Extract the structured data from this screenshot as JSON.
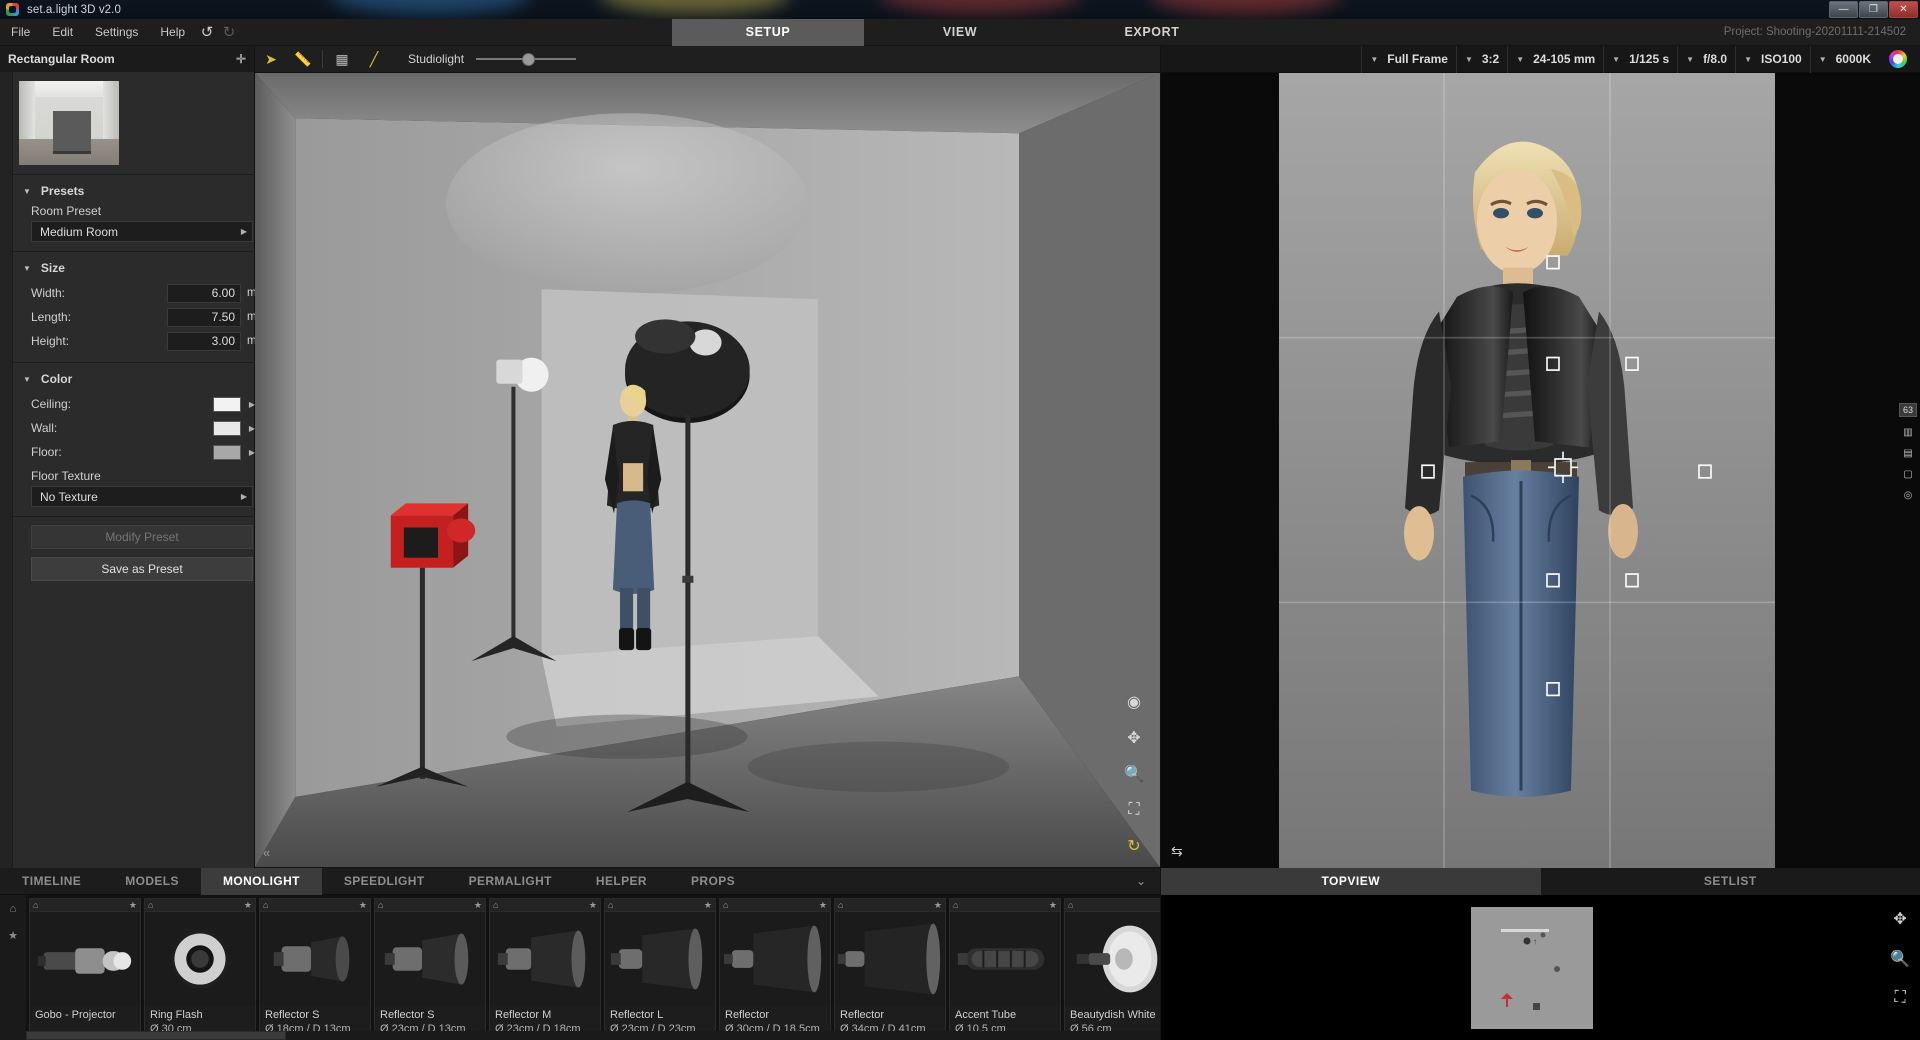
{
  "window": {
    "app_title": "set.a.light 3D v2.0",
    "logo_icon": "app-logo-icon",
    "minimize_icon": "minimize-icon",
    "maximize_icon": "maximize-icon",
    "close_icon": "close-icon",
    "minimize_glyph": "—",
    "maximize_glyph": "❐",
    "close_glyph": "✕"
  },
  "menu": {
    "items": [
      "File",
      "Edit",
      "Settings",
      "Help"
    ],
    "undo_glyph": "↺",
    "redo_glyph": "↻",
    "project_label": "Project: Shooting-20201111-214502"
  },
  "nav_tabs": [
    {
      "label": "SETUP",
      "active": true
    },
    {
      "label": "VIEW",
      "active": false
    },
    {
      "label": "EXPORT",
      "active": false
    }
  ],
  "sidebar": {
    "header": "Rectangular Room",
    "pin_glyph": "📌",
    "presets": {
      "section_label": "Presets",
      "caret_glyph": "▼",
      "field_label": "Room Preset",
      "value": "Medium Room",
      "arrow_glyph": "▶"
    },
    "size": {
      "section_label": "Size",
      "caret_glyph": "▼",
      "rows": [
        {
          "label": "Width:",
          "value": "6.00",
          "unit": "m"
        },
        {
          "label": "Length:",
          "value": "7.50",
          "unit": "m"
        },
        {
          "label": "Height:",
          "value": "3.00",
          "unit": "m"
        }
      ]
    },
    "color": {
      "section_label": "Color",
      "caret_glyph": "▼",
      "rows": [
        {
          "label": "Ceiling:",
          "swatch": "#f2f2f2",
          "arrow_glyph": "▶"
        },
        {
          "label": "Wall:",
          "swatch": "#e8e8e8",
          "arrow_glyph": "▶"
        },
        {
          "label": "Floor:",
          "swatch": "#a8a8a8",
          "arrow_glyph": "▶"
        }
      ],
      "texture_label": "Floor Texture",
      "texture_value": "No Texture",
      "texture_arrow": "▶"
    },
    "buttons": {
      "modify_preset": "Modify Preset",
      "save_as_preset": "Save as Preset"
    }
  },
  "viewport_toolbar": {
    "select_icon": "cursor-arrow-icon",
    "select_glyph": "➤",
    "measure_icon": "ruler-icon",
    "measure_glyph": "📏",
    "grid_icon": "grid-icon",
    "grid_glyph": "▦",
    "line_icon": "line-tool-icon",
    "line_glyph": "╱",
    "studiolight_label": "Studiolight",
    "studiolight_value": 46
  },
  "viewport_gizmos": [
    {
      "name": "orbit-target-icon",
      "glyph": "◉"
    },
    {
      "name": "pan-move-icon",
      "glyph": "✥"
    },
    {
      "name": "zoom-icon",
      "glyph": "🔍"
    },
    {
      "name": "fit-to-screen-icon",
      "glyph": "⛶"
    },
    {
      "name": "rotate-orbit-icon",
      "glyph": "↻"
    }
  ],
  "viewport_collapse_glyph": "«",
  "camera_toolbar": {
    "settings": [
      {
        "name": "sensor-format-select",
        "value": "Full Frame",
        "arrow": "▼"
      },
      {
        "name": "aspect-ratio-select",
        "value": "3:2",
        "arrow": "▼"
      },
      {
        "name": "focal-length-select",
        "value": "24-105 mm",
        "arrow": "▼"
      },
      {
        "name": "shutter-speed-select",
        "value": "1/125 s",
        "arrow": "▼"
      },
      {
        "name": "aperture-select",
        "value": "f/8.0",
        "arrow": "▼"
      },
      {
        "name": "iso-select",
        "value": "ISO100",
        "arrow": "▼"
      },
      {
        "name": "white-balance-select",
        "value": "6000K",
        "arrow": "▼"
      }
    ],
    "color_wheel_icon": "color-wheel-icon"
  },
  "camera_rail": {
    "counter": "63",
    "items": [
      {
        "name": "histogram-icon",
        "glyph": "▥"
      },
      {
        "name": "ruler-scale-icon",
        "glyph": "▤"
      },
      {
        "name": "frame-icon",
        "glyph": "▢"
      },
      {
        "name": "focus-point-icon",
        "glyph": "◎"
      }
    ],
    "flip_icon": "flip-horizontal-icon",
    "flip_glyph": "⇆"
  },
  "light_tabs": [
    {
      "label": "TIMELINE",
      "active": false
    },
    {
      "label": "MODELS",
      "active": false
    },
    {
      "label": "MONOLIGHT",
      "active": true
    },
    {
      "label": "SPEEDLIGHT",
      "active": false
    },
    {
      "label": "PERMALIGHT",
      "active": false
    },
    {
      "label": "HELPER",
      "active": false
    },
    {
      "label": "PROPS",
      "active": false
    }
  ],
  "light_tabs_collapse_glyph": "⌄",
  "strip_rail": {
    "home_glyph": "⌂",
    "star_glyph": "★"
  },
  "lights": [
    {
      "name": "Gobo - Projector",
      "spec": "",
      "shape": "projector",
      "pin": "⌂",
      "star": "★"
    },
    {
      "name": "Ring Flash",
      "spec": "Ø 30 cm",
      "shape": "ring",
      "pin": "⌂",
      "star": "★"
    },
    {
      "name": "Reflector S",
      "spec": "Ø 18cm / D 13cm",
      "shape": "reflector-s",
      "pin": "⌂",
      "star": "★"
    },
    {
      "name": "Reflector S",
      "spec": "Ø 23cm / D 13cm",
      "shape": "reflector-s2",
      "pin": "⌂",
      "star": "★"
    },
    {
      "name": "Reflector M",
      "spec": "Ø 23cm / D 18cm",
      "shape": "reflector-m",
      "pin": "⌂",
      "star": "★"
    },
    {
      "name": "Reflector L",
      "spec": "Ø 23cm / D 23cm",
      "shape": "reflector-l",
      "pin": "⌂",
      "star": "★"
    },
    {
      "name": "Reflector",
      "spec": "Ø 30cm / D 18,5cm",
      "shape": "reflector-xl",
      "pin": "⌂",
      "star": "★"
    },
    {
      "name": "Reflector",
      "spec": "Ø 34cm / D 41cm",
      "shape": "reflector-xxl",
      "pin": "⌂",
      "star": "★"
    },
    {
      "name": "Accent Tube",
      "spec": "Ø 10,5 cm",
      "shape": "tube",
      "pin": "⌂",
      "star": "★"
    },
    {
      "name": "Beautydish White",
      "spec": "Ø 56 cm",
      "shape": "beautydish",
      "pin": "⌂",
      "star": "★"
    }
  ],
  "bottom_right_tabs": [
    {
      "label": "TOPVIEW",
      "active": true
    },
    {
      "label": "SETLIST",
      "active": false
    }
  ],
  "topview_tools": [
    {
      "name": "pan-move-icon",
      "glyph": "✥"
    },
    {
      "name": "zoom-icon",
      "glyph": "🔍"
    },
    {
      "name": "fit-to-screen-icon",
      "glyph": "⛶"
    }
  ],
  "colors": {
    "accent": "#5b5b5b",
    "panel_bg": "#2b2b2b",
    "dark_bg": "#1a1a1a",
    "close_red": "#c0504a",
    "tool_yellow": "#d8c030"
  }
}
